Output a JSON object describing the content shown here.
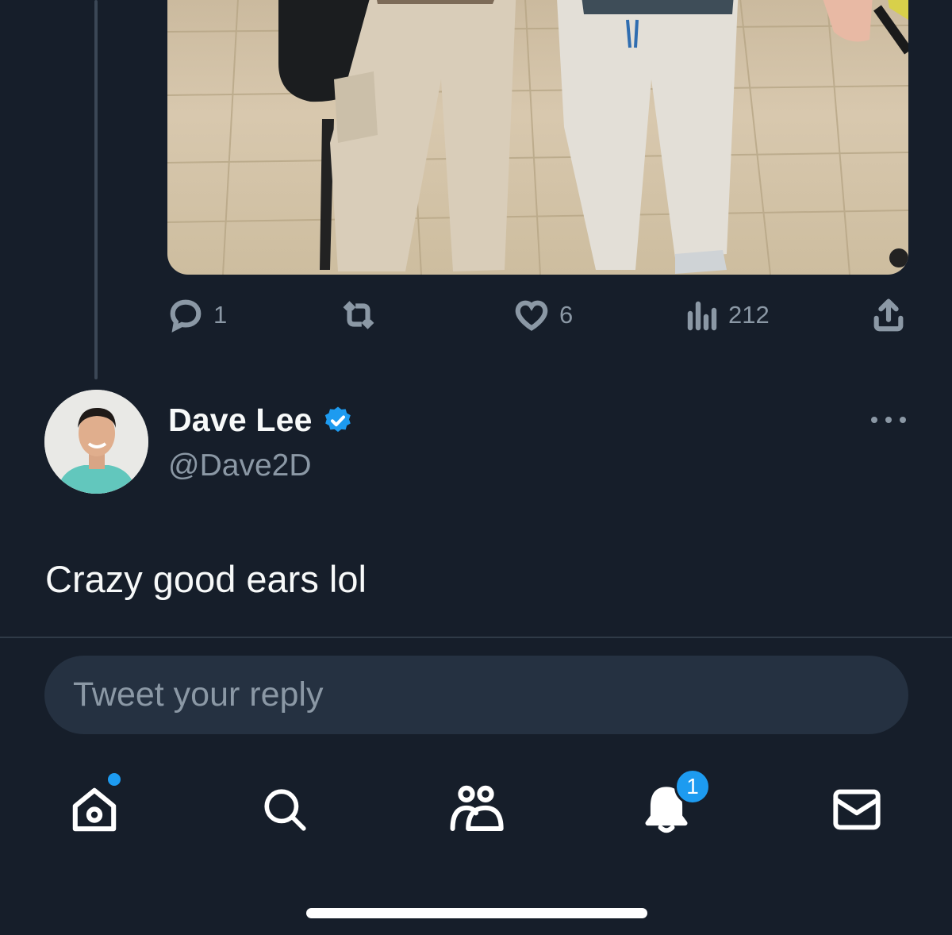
{
  "tweet": {
    "actions": {
      "replies": "1",
      "likes": "6",
      "views": "212"
    }
  },
  "reply": {
    "author_name": "Dave Lee",
    "author_handle": "@Dave2D",
    "text": "Crazy good ears lol",
    "verified": true
  },
  "composer": {
    "placeholder": "Tweet your reply"
  },
  "tabbar": {
    "notifications_badge": "1",
    "home_has_dot": true
  },
  "colors": {
    "background": "#161e2a",
    "accent": "#1d9bf0",
    "muted_text": "#8b98a5"
  },
  "icons": [
    "reply-icon",
    "retweet-icon",
    "like-icon",
    "views-icon",
    "share-icon",
    "verified-icon",
    "more-icon",
    "home-icon",
    "search-icon",
    "communities-icon",
    "notifications-icon",
    "messages-icon"
  ]
}
